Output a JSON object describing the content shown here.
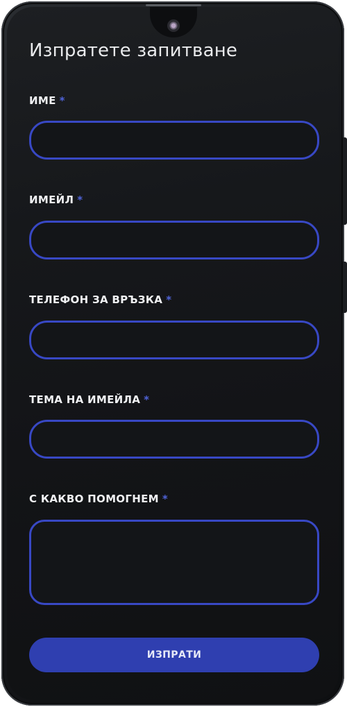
{
  "form": {
    "title": "Изпратете запитване",
    "required_mark": "*",
    "fields": [
      {
        "label": "ИМЕ",
        "value": "",
        "placeholder": ""
      },
      {
        "label": "ИМЕЙЛ",
        "value": "",
        "placeholder": ""
      },
      {
        "label": "ТЕЛЕФОН ЗА ВРЪЗКА",
        "value": "",
        "placeholder": ""
      },
      {
        "label": "ТЕМА НА ИМЕЙЛА",
        "value": "",
        "placeholder": ""
      },
      {
        "label": "С КАКВО ПОМОГНЕМ",
        "value": "",
        "placeholder": ""
      }
    ],
    "submit_label": "ИЗПРАТИ"
  },
  "colors": {
    "accent": "#3848c4",
    "button": "#2f3fb0",
    "required": "#4f63d8",
    "background": "#16181b"
  }
}
